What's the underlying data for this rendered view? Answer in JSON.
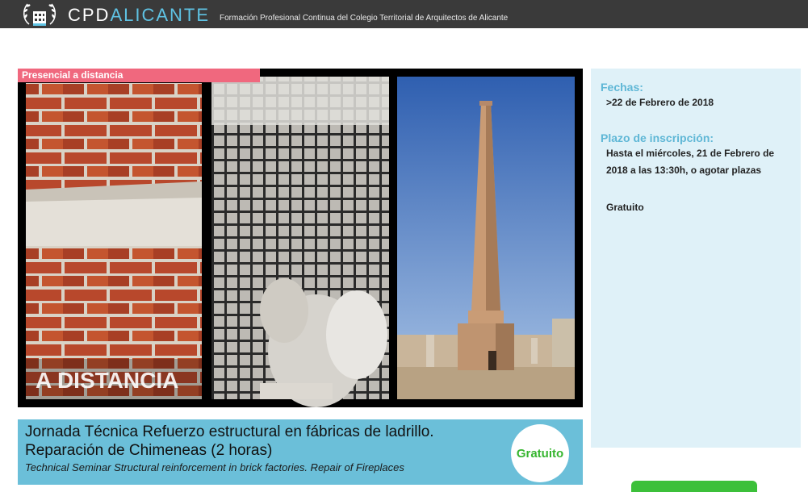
{
  "header": {
    "brand_cpd": "CPD",
    "brand_city": "ALICANTE",
    "tagline": "Formación Profesional Continua del Colegio Territorial de Arquitectos de Alicante"
  },
  "course": {
    "modality_badge": "Presencial a distancia",
    "image_overlay_text": "A DISTANCIA",
    "title": "Jornada Técnica Refuerzo estructural en fábricas de ladrillo. Reparación de Chimeneas (2 horas)",
    "subtitle": "Technical Seminar Structural reinforcement in brick factories. Repair of Fireplaces",
    "price_label": "Gratuito"
  },
  "info": {
    "dates_heading": "Fechas:",
    "dates_value": ">22 de Febrero de 2018",
    "deadline_heading": "Plazo de inscripción:",
    "deadline_value": "Hasta el miércoles, 21 de Febrero de 2018 a las 13:30h, o agotar plazas",
    "price_value": "Gratuito"
  },
  "colors": {
    "header_bg": "#3a3a3a",
    "brand_accent": "#5fc3e4",
    "badge_bg": "#f0687e",
    "title_card_bg": "#6bbfd9",
    "info_panel_bg": "#dff1f8",
    "price_text": "#35b52e",
    "action_button": "#3cc03a"
  }
}
